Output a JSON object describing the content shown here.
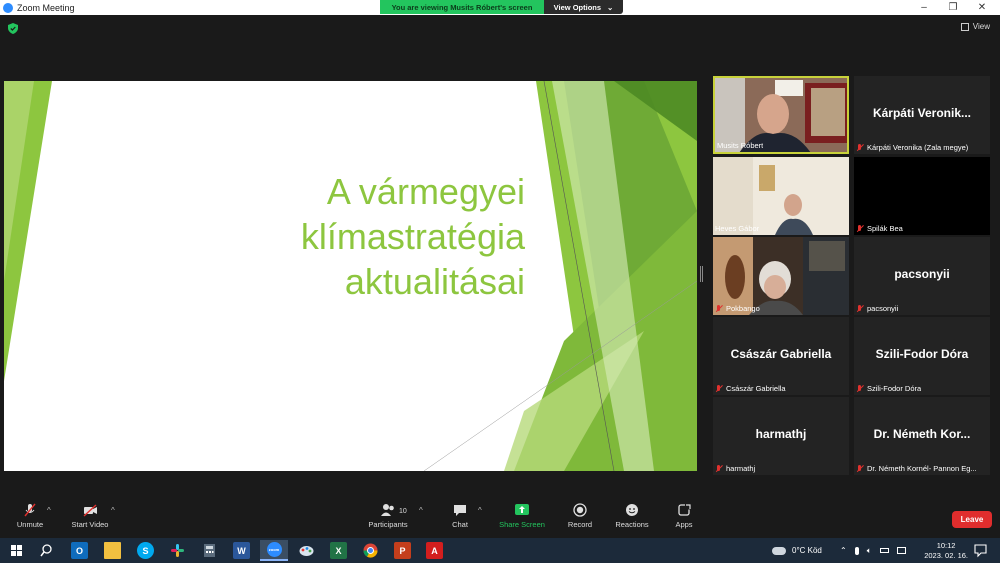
{
  "window": {
    "title": "Zoom Meeting",
    "minimize": "–",
    "maximize": "❐",
    "close": "✕"
  },
  "share_banner": {
    "message": "You are viewing Musits Róbert's screen",
    "options_label": "View Options",
    "options_caret": "⌄"
  },
  "view_button": {
    "label": "View"
  },
  "slide": {
    "title_lines": [
      "A vármegyei",
      "klímastratégia",
      "aktualitásai"
    ],
    "accent_color": "#8dc63f"
  },
  "participants": [
    {
      "tile_name": "",
      "label": "Musits Róbert",
      "muted": false,
      "has_video": true,
      "active_speaker": true
    },
    {
      "tile_name": "Kárpáti Veronik...",
      "label": "Kárpáti Veronika (Zala megye)",
      "muted": true,
      "has_video": false
    },
    {
      "tile_name": "",
      "label": "Heves Gábor",
      "muted": false,
      "has_video": true
    },
    {
      "tile_name": "",
      "label": "Spilák Bea",
      "muted": true,
      "has_video": false
    },
    {
      "tile_name": "",
      "label": "Pokbango",
      "muted": true,
      "has_video": true
    },
    {
      "tile_name": "pacsonyii",
      "label": "pacsonyii",
      "muted": true,
      "has_video": false
    },
    {
      "tile_name": "Császár Gabriella",
      "label": "Császár Gabriella",
      "muted": true,
      "has_video": false
    },
    {
      "tile_name": "Szili-Fodor Dóra",
      "label": "Szili-Fodor Dóra",
      "muted": true,
      "has_video": false
    },
    {
      "tile_name": "harmathj",
      "label": "harmathj",
      "muted": true,
      "has_video": false
    },
    {
      "tile_name": "Dr. Németh Kor...",
      "label": "Dr. Németh Kornél- Pannon Eg...",
      "muted": true,
      "has_video": false
    }
  ],
  "toolbar": {
    "unmute": "Unmute",
    "start_video": "Start Video",
    "participants": "Participants",
    "participants_count": "10",
    "chat": "Chat",
    "share_screen": "Share Screen",
    "record": "Record",
    "reactions": "Reactions",
    "apps": "Apps",
    "leave": "Leave",
    "caret": "^"
  },
  "taskbar": {
    "weather": "0°C  Köd",
    "time": "10:12",
    "date": "2023. 02. 16.",
    "apps": [
      "start",
      "search",
      "outlook",
      "explorer",
      "skype",
      "slack",
      "calculator",
      "word",
      "zoom",
      "paint",
      "excel",
      "chrome",
      "powerpoint",
      "acrobat"
    ],
    "labels": {
      "outlook": "O",
      "skype": "S",
      "word": "W",
      "zoom": "zoom",
      "excel": "X",
      "powerpoint": "P",
      "acrobat": "A"
    }
  }
}
